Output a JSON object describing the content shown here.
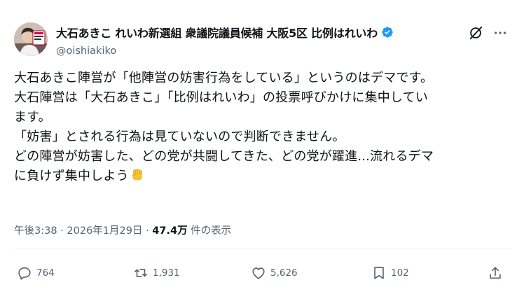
{
  "author": {
    "display_name": "大石あきこ れいわ新選組 衆議院議員候補 大阪5区 比例はれいわ",
    "handle": "@oishiakiko",
    "avatar_label": "大石"
  },
  "tweet": {
    "lines": [
      "大石あきこ陣営が「他陣営の妨害行為をしている」というのはデマです。",
      "大石陣営は「大石あきこ」「比例はれいわ」の投票呼びかけに集中してい",
      "ます。",
      "「妨害」とされる行為は見ていないので判断できません。",
      "どの陣営が妨害した、どの党が共闘してきた、どの党が躍進...流れるデマ",
      "に負けず集中しよう"
    ],
    "emoji": "raised-fist"
  },
  "meta": {
    "time": "午後3:38",
    "sep1": " · ",
    "date": "2026年1月29日",
    "sep2": " · ",
    "views": "47.4万",
    "views_label": " 件の表示"
  },
  "actions": {
    "replies": "764",
    "reposts": "1,931",
    "likes": "5,626",
    "bookmarks": "102"
  },
  "colors": {
    "text": "#0f1419",
    "secondary": "#536471",
    "verified": "#1d9bf0",
    "divider": "#eff3f4",
    "emoji": "#f5c33b"
  },
  "icons": [
    "verified-badge-icon",
    "grok-icon",
    "more-icon",
    "reply-icon",
    "repost-icon",
    "like-icon",
    "bookmark-icon",
    "share-icon",
    "raised-fist-emoji"
  ]
}
